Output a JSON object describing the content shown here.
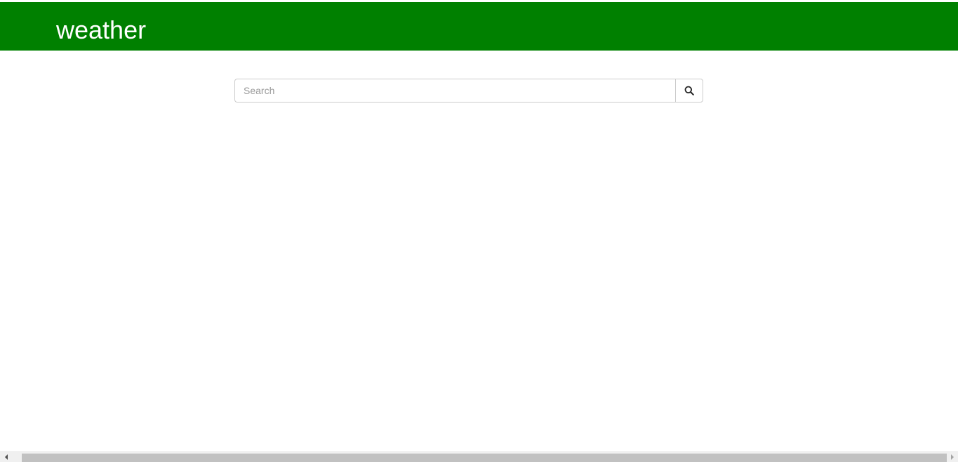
{
  "header": {
    "title": "weather",
    "background_color": "#008000",
    "title_color": "#ffffff"
  },
  "search": {
    "placeholder": "Search",
    "value": "",
    "button_icon": "search-icon"
  },
  "scrollbar": {
    "orientation": "horizontal",
    "left_arrow_icon": "triangle-left-icon",
    "right_arrow_icon": "triangle-right-icon"
  }
}
